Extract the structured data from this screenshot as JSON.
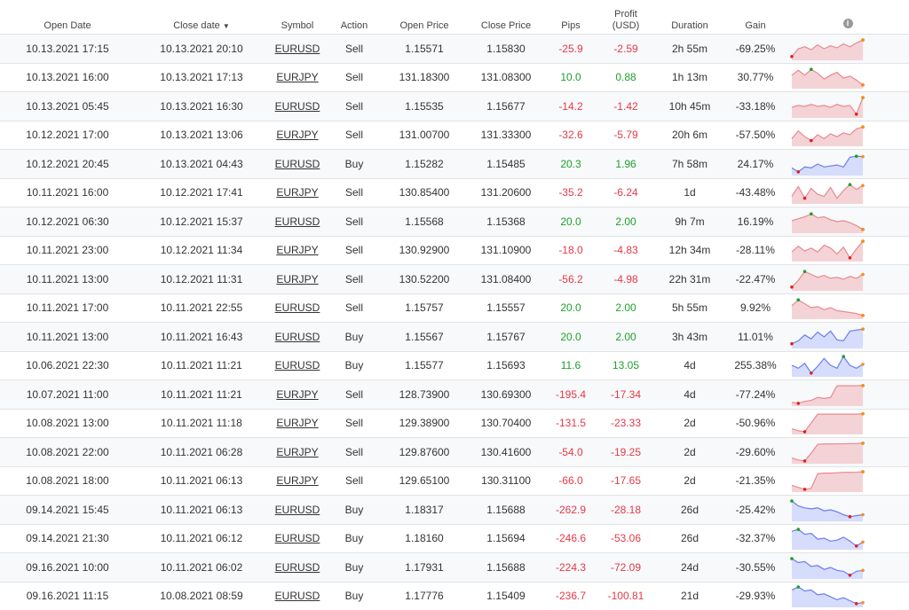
{
  "headers": {
    "open_date": "Open Date",
    "close_date": "Close date",
    "symbol": "Symbol",
    "action": "Action",
    "open_price": "Open Price",
    "close_price": "Close Price",
    "pips": "Pips",
    "profit_line1": "Profit",
    "profit_line2": "(USD)",
    "duration": "Duration",
    "gain": "Gain"
  },
  "sort_icon": "sort-desc-icon",
  "info_icon": "info-icon",
  "colors": {
    "negative": "#e63946",
    "positive": "#1fa12a",
    "sell_fill": "#f4d3d6",
    "sell_line": "#e88a8f",
    "buy_fill": "#d6dcfb",
    "buy_line": "#6b7ef0"
  },
  "rows": [
    {
      "open": "10.13.2021 17:15",
      "close": "10.13.2021 20:10",
      "symbol": "EURUSD",
      "action": "Sell",
      "open_price": "1.15571",
      "close_price": "1.15830",
      "pips": "-25.9",
      "profit": "-2.59",
      "duration": "2h 55m",
      "gain": "-69.25%",
      "spark": [
        0.1,
        0.5,
        0.6,
        0.45,
        0.7,
        0.5,
        0.65,
        0.55,
        0.75,
        0.6,
        0.8,
        0.95
      ]
    },
    {
      "open": "10.13.2021 16:00",
      "close": "10.13.2021 17:13",
      "symbol": "EURJPY",
      "action": "Sell",
      "open_price": "131.18300",
      "close_price": "131.08300",
      "pips": "10.0",
      "profit": "0.88",
      "duration": "1h 13m",
      "gain": "30.77%",
      "spark": [
        0.6,
        0.85,
        0.6,
        0.9,
        0.7,
        0.4,
        0.6,
        0.75,
        0.45,
        0.55,
        0.35,
        0.1
      ]
    },
    {
      "open": "10.13.2021 05:45",
      "close": "10.13.2021 16:30",
      "symbol": "EURUSD",
      "action": "Sell",
      "open_price": "1.15535",
      "close_price": "1.15677",
      "pips": "-14.2",
      "profit": "-1.42",
      "duration": "10h 45m",
      "gain": "-33.18%",
      "spark": [
        0.45,
        0.55,
        0.5,
        0.6,
        0.5,
        0.55,
        0.45,
        0.6,
        0.5,
        0.55,
        0.1,
        0.95
      ]
    },
    {
      "open": "10.12.2021 17:00",
      "close": "10.13.2021 13:06",
      "symbol": "EURJPY",
      "action": "Sell",
      "open_price": "131.00700",
      "close_price": "131.33300",
      "pips": "-32.6",
      "profit": "-5.79",
      "duration": "20h 6m",
      "gain": "-57.50%",
      "spark": [
        0.3,
        0.7,
        0.4,
        0.2,
        0.5,
        0.3,
        0.55,
        0.4,
        0.6,
        0.5,
        0.8,
        0.9
      ]
    },
    {
      "open": "10.12.2021 20:45",
      "close": "10.13.2021 04:43",
      "symbol": "EURUSD",
      "action": "Buy",
      "open_price": "1.15282",
      "close_price": "1.15485",
      "pips": "20.3",
      "profit": "1.96",
      "duration": "7h 58m",
      "gain": "24.17%",
      "spark": [
        0.3,
        0.1,
        0.35,
        0.3,
        0.5,
        0.35,
        0.4,
        0.45,
        0.35,
        0.85,
        0.9,
        0.88
      ]
    },
    {
      "open": "10.11.2021 16:00",
      "close": "10.12.2021 17:41",
      "symbol": "EURJPY",
      "action": "Sell",
      "open_price": "130.85400",
      "close_price": "131.20600",
      "pips": "-35.2",
      "profit": "-6.24",
      "duration": "1d",
      "gain": "-43.48%",
      "spark": [
        0.3,
        0.8,
        0.2,
        0.7,
        0.4,
        0.3,
        0.75,
        0.2,
        0.6,
        0.9,
        0.65,
        0.85
      ]
    },
    {
      "open": "10.12.2021 06:30",
      "close": "10.12.2021 15:37",
      "symbol": "EURUSD",
      "action": "Sell",
      "open_price": "1.15568",
      "close_price": "1.15368",
      "pips": "20.0",
      "profit": "2.00",
      "duration": "9h 7m",
      "gain": "16.19%",
      "spark": [
        0.55,
        0.65,
        0.75,
        0.9,
        0.7,
        0.75,
        0.6,
        0.5,
        0.55,
        0.45,
        0.3,
        0.1
      ]
    },
    {
      "open": "10.11.2021 23:00",
      "close": "10.12.2021 11:34",
      "symbol": "EURJPY",
      "action": "Sell",
      "open_price": "130.92900",
      "close_price": "131.10900",
      "pips": "-18.0",
      "profit": "-4.83",
      "duration": "12h 34m",
      "gain": "-28.11%",
      "spark": [
        0.4,
        0.7,
        0.45,
        0.6,
        0.4,
        0.75,
        0.6,
        0.3,
        0.65,
        0.1,
        0.55,
        0.95
      ]
    },
    {
      "open": "10.11.2021 13:00",
      "close": "10.12.2021 11:31",
      "symbol": "EURJPY",
      "action": "Sell",
      "open_price": "130.52200",
      "close_price": "131.08400",
      "pips": "-56.2",
      "profit": "-4.98",
      "duration": "22h 31m",
      "gain": "-22.47%",
      "spark": [
        0.1,
        0.45,
        0.9,
        0.75,
        0.6,
        0.7,
        0.55,
        0.6,
        0.5,
        0.65,
        0.55,
        0.75
      ]
    },
    {
      "open": "10.11.2021 17:00",
      "close": "10.11.2021 22:55",
      "symbol": "EURUSD",
      "action": "Sell",
      "open_price": "1.15757",
      "close_price": "1.15557",
      "pips": "20.0",
      "profit": "2.00",
      "duration": "5h 55m",
      "gain": "9.92%",
      "spark": [
        0.6,
        0.9,
        0.7,
        0.5,
        0.55,
        0.4,
        0.5,
        0.35,
        0.3,
        0.25,
        0.2,
        0.1
      ]
    },
    {
      "open": "10.11.2021 13:00",
      "close": "10.11.2021 16:43",
      "symbol": "EURUSD",
      "action": "Buy",
      "open_price": "1.15567",
      "close_price": "1.15767",
      "pips": "20.0",
      "profit": "2.00",
      "duration": "3h 43m",
      "gain": "11.01%",
      "spark": [
        0.15,
        0.3,
        0.6,
        0.4,
        0.75,
        0.5,
        0.8,
        0.35,
        0.3,
        0.8,
        0.85,
        0.9
      ]
    },
    {
      "open": "10.06.2021 22:30",
      "close": "10.11.2021 11:21",
      "symbol": "EURUSD",
      "action": "Buy",
      "open_price": "1.15577",
      "close_price": "1.15693",
      "pips": "11.6",
      "profit": "13.05",
      "duration": "4d",
      "gain": "255.38%",
      "spark": [
        0.5,
        0.35,
        0.6,
        0.1,
        0.45,
        0.85,
        0.5,
        0.35,
        0.95,
        0.5,
        0.35,
        0.55
      ]
    },
    {
      "open": "10.07.2021 11:00",
      "close": "10.11.2021 11:21",
      "symbol": "EURJPY",
      "action": "Sell",
      "open_price": "128.73900",
      "close_price": "130.69300",
      "pips": "-195.4",
      "profit": "-17.34",
      "duration": "4d",
      "gain": "-77.24%",
      "spark": [
        0.1,
        0.05,
        0.15,
        0.2,
        0.35,
        0.3,
        0.35,
        0.95,
        0.95,
        0.95,
        0.95,
        0.96
      ]
    },
    {
      "open": "10.08.2021 13:00",
      "close": "10.11.2021 11:18",
      "symbol": "EURJPY",
      "action": "Sell",
      "open_price": "129.38900",
      "close_price": "130.70400",
      "pips": "-131.5",
      "profit": "-23.33",
      "duration": "2d",
      "gain": "-50.96%",
      "spark": [
        0.2,
        0.1,
        0.05,
        0.5,
        0.95,
        0.95,
        0.95,
        0.95,
        0.95,
        0.95,
        0.95,
        0.97
      ]
    },
    {
      "open": "10.08.2021 22:00",
      "close": "10.11.2021 06:28",
      "symbol": "EURJPY",
      "action": "Sell",
      "open_price": "129.87600",
      "close_price": "130.41600",
      "pips": "-54.0",
      "profit": "-19.25",
      "duration": "2d",
      "gain": "-29.60%",
      "spark": [
        0.2,
        0.1,
        0.05,
        0.45,
        0.9,
        0.92,
        0.92,
        0.93,
        0.93,
        0.94,
        0.94,
        0.96
      ]
    },
    {
      "open": "10.08.2021 18:00",
      "close": "10.11.2021 06:13",
      "symbol": "EURJPY",
      "action": "Sell",
      "open_price": "129.65100",
      "close_price": "130.31100",
      "pips": "-66.0",
      "profit": "-17.65",
      "duration": "2d",
      "gain": "-21.35%",
      "spark": [
        0.25,
        0.15,
        0.05,
        0.1,
        0.85,
        0.88,
        0.88,
        0.9,
        0.92,
        0.92,
        0.93,
        0.95
      ]
    },
    {
      "open": "09.14.2021 15:45",
      "close": "10.11.2021 06:13",
      "symbol": "EURUSD",
      "action": "Buy",
      "open_price": "1.18317",
      "close_price": "1.15688",
      "pips": "-262.9",
      "profit": "-28.18",
      "duration": "26d",
      "gain": "-25.42%",
      "spark": [
        0.95,
        0.7,
        0.6,
        0.55,
        0.6,
        0.45,
        0.5,
        0.4,
        0.25,
        0.15,
        0.2,
        0.25
      ]
    },
    {
      "open": "09.14.2021 21:30",
      "close": "10.11.2021 06:12",
      "symbol": "EURUSD",
      "action": "Buy",
      "open_price": "1.18160",
      "close_price": "1.15694",
      "pips": "-246.6",
      "profit": "-53.06",
      "duration": "26d",
      "gain": "-32.37%",
      "spark": [
        0.85,
        0.95,
        0.7,
        0.75,
        0.45,
        0.5,
        0.35,
        0.4,
        0.55,
        0.35,
        0.1,
        0.3
      ]
    },
    {
      "open": "09.16.2021 10:00",
      "close": "10.11.2021 06:02",
      "symbol": "EURUSD",
      "action": "Buy",
      "open_price": "1.17931",
      "close_price": "1.15688",
      "pips": "-224.3",
      "profit": "-72.09",
      "duration": "24d",
      "gain": "-30.55%",
      "spark": [
        0.95,
        0.75,
        0.8,
        0.55,
        0.6,
        0.4,
        0.5,
        0.35,
        0.3,
        0.1,
        0.3,
        0.35
      ]
    },
    {
      "open": "09.16.2021 11:15",
      "close": "10.08.2021 08:59",
      "symbol": "EURUSD",
      "action": "Buy",
      "open_price": "1.17776",
      "close_price": "1.15409",
      "pips": "-236.7",
      "profit": "-100.81",
      "duration": "21d",
      "gain": "-29.93%",
      "spark": [
        0.8,
        0.95,
        0.75,
        0.8,
        0.55,
        0.6,
        0.45,
        0.3,
        0.4,
        0.25,
        0.1,
        0.15
      ]
    }
  ]
}
